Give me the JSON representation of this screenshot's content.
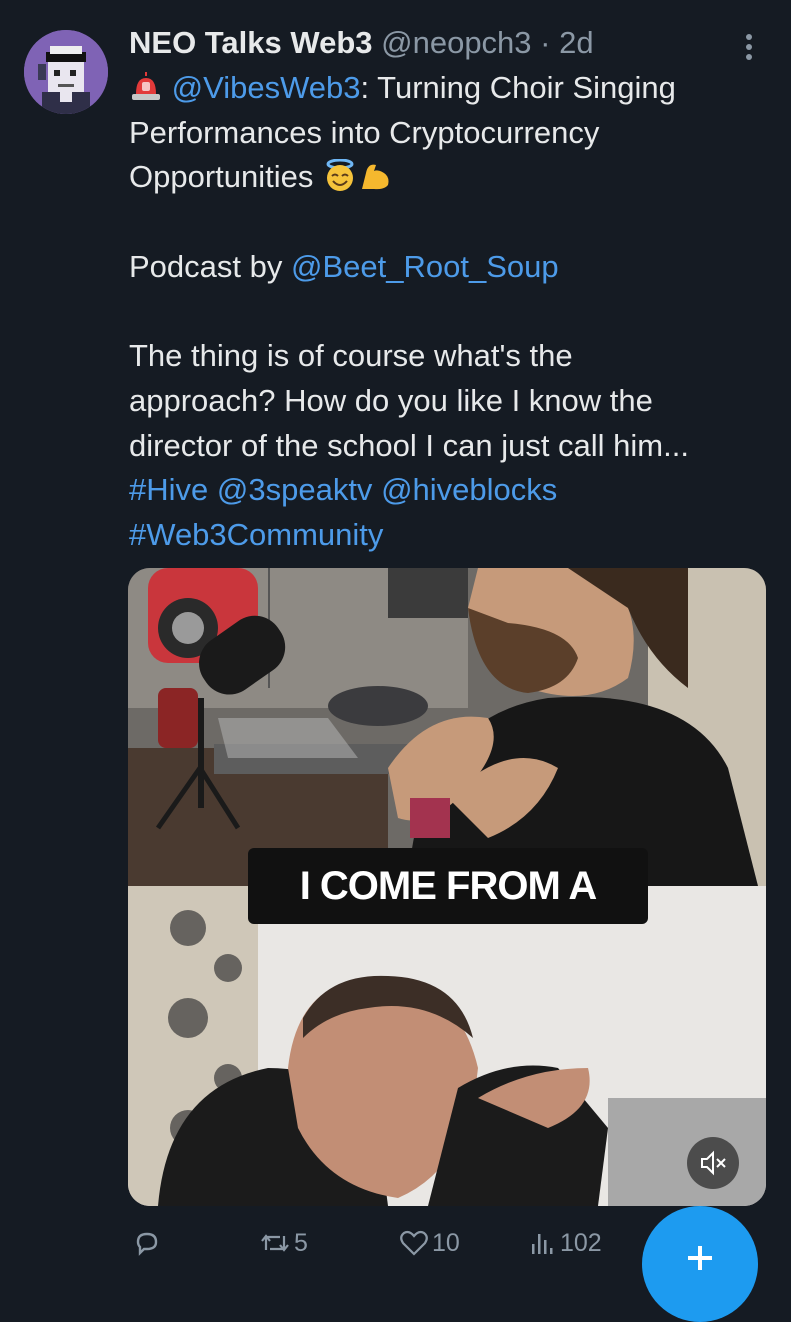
{
  "author": {
    "name": "NEO Talks Web3",
    "handle": "@neopch3",
    "separator": "·",
    "time": "2d"
  },
  "tweet": {
    "line1_mention": "@VibesWeb3",
    "line1_text": ": Turning Choir Singing",
    "line2": "Performances into Cryptocurrency",
    "line3": "Opportunities",
    "podcast_prefix": "Podcast by ",
    "podcast_mention": "@Beet_Root_Soup",
    "quote_line1": "The thing is of course what's the",
    "quote_line2": "approach? How do you like I know the",
    "quote_line3": "director of the school I can just call him...",
    "tags_line1": [
      "#Hive",
      "@3speaktv",
      "@hiveblocks"
    ],
    "tags_line2": [
      "#Web3Community"
    ]
  },
  "media": {
    "caption": "I COME FROM A"
  },
  "actions": {
    "retweets": "5",
    "likes": "10",
    "views": "102"
  },
  "icons": {
    "more": "more-vertical-icon",
    "siren": "siren-emoji",
    "angel": "smiling-halo-emoji",
    "muscle": "flexed-biceps-emoji",
    "reply": "reply-icon",
    "retweet": "retweet-icon",
    "like": "heart-icon",
    "views": "views-icon",
    "mute": "speaker-muted-icon",
    "compose": "plus-icon"
  },
  "colors": {
    "background": "#151b23",
    "link": "#4d9be9",
    "muted": "#8b98a5",
    "accent": "#1d9bf0"
  }
}
